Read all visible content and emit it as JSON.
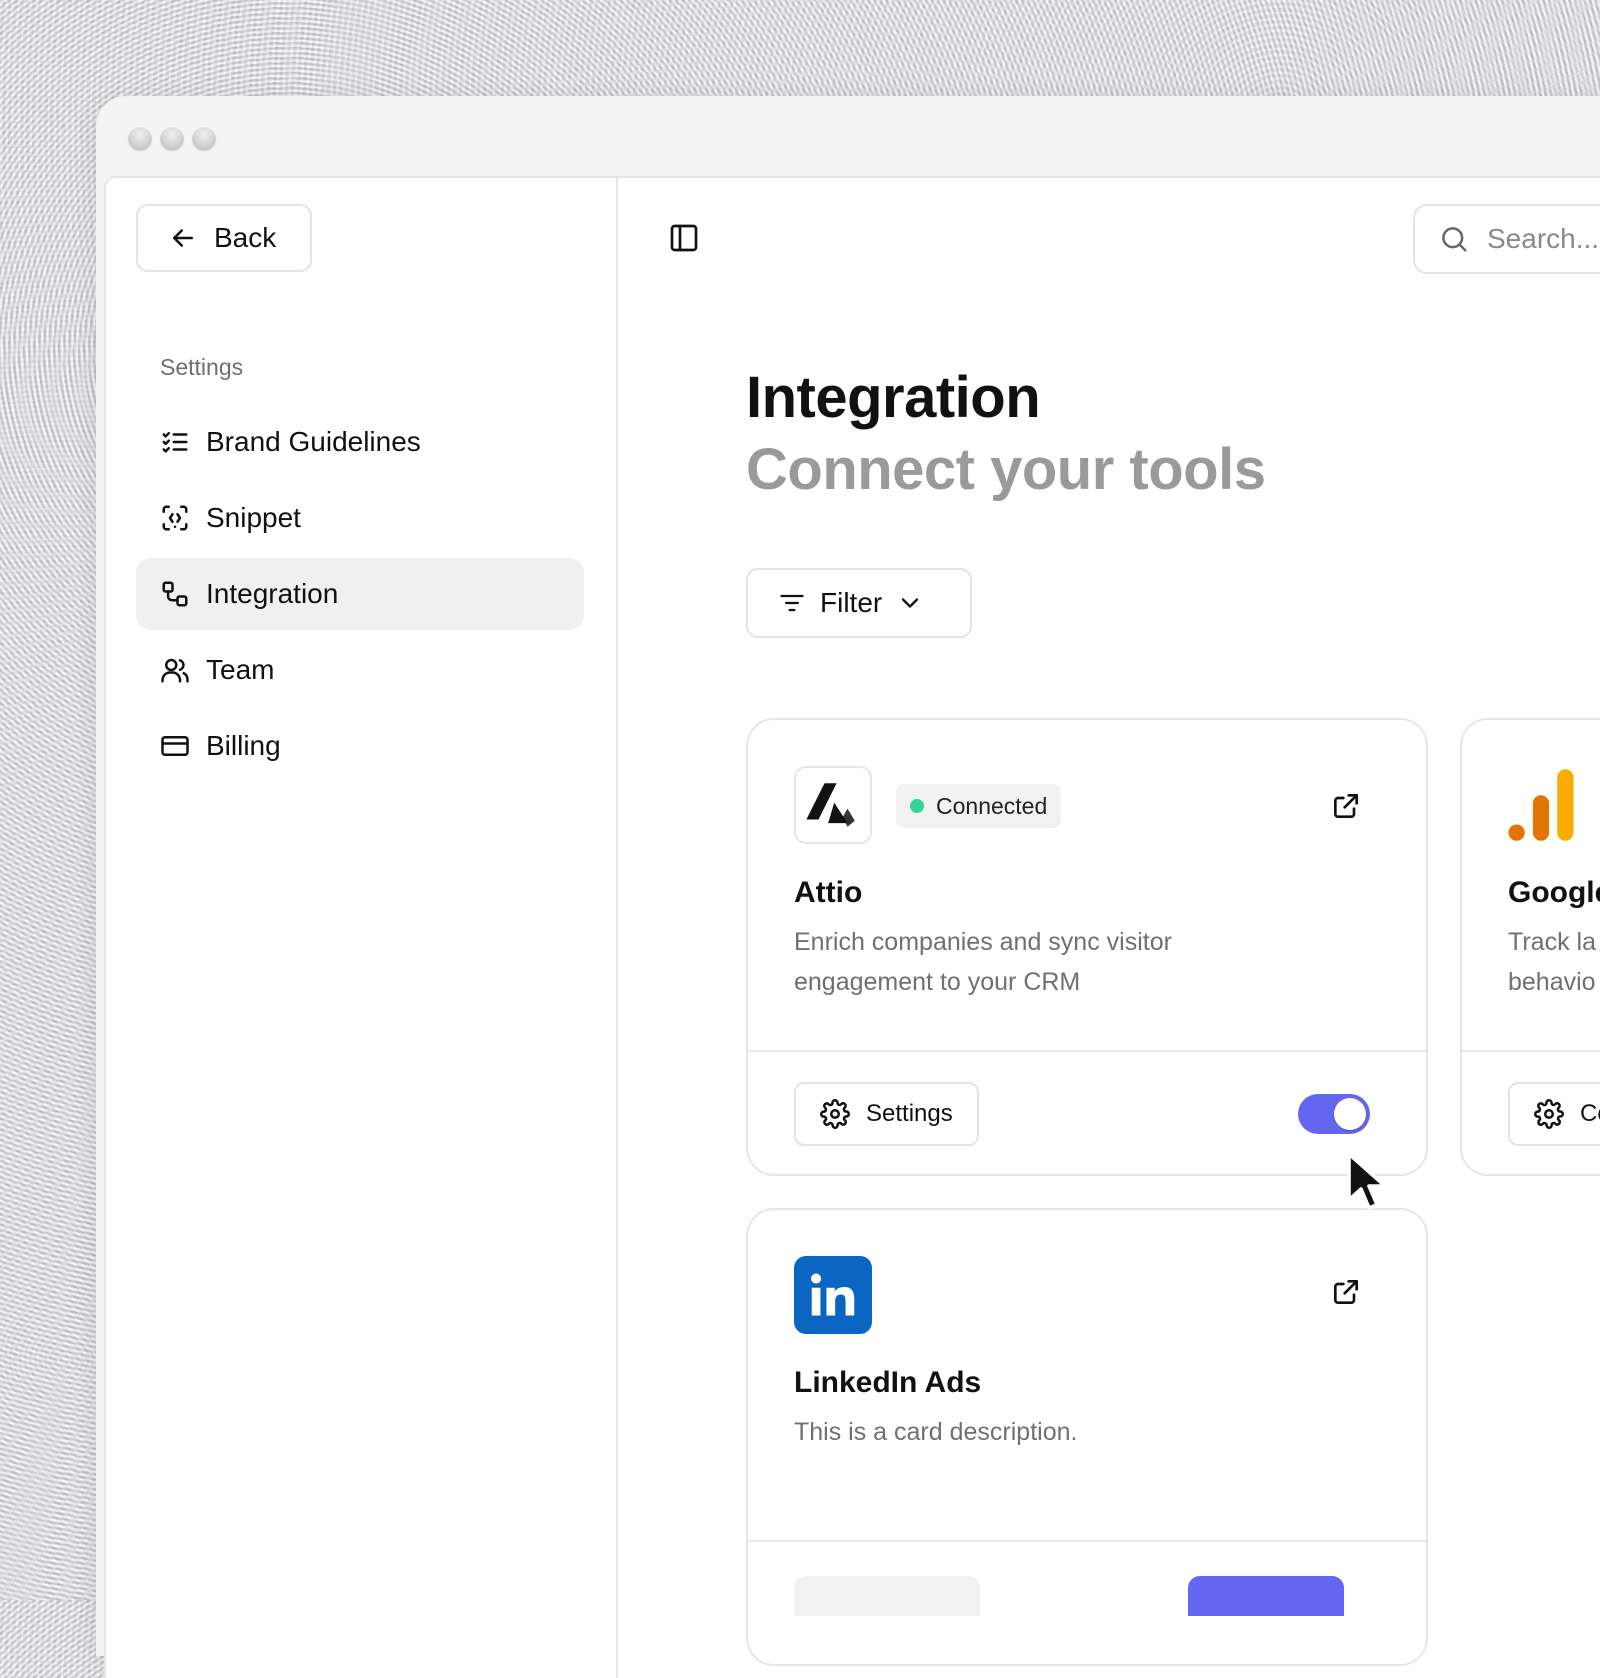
{
  "window": {
    "controls": [
      "close",
      "minimize",
      "zoom"
    ]
  },
  "sidebar": {
    "back_label": "Back",
    "section_label": "Settings",
    "items": [
      {
        "label": "Brand Guidelines",
        "icon": "checklist-icon",
        "active": false
      },
      {
        "label": "Snippet",
        "icon": "code-snippet-icon",
        "active": false
      },
      {
        "label": "Integration",
        "icon": "integration-icon",
        "active": true
      },
      {
        "label": "Team",
        "icon": "users-icon",
        "active": false
      },
      {
        "label": "Billing",
        "icon": "credit-card-icon",
        "active": false
      }
    ]
  },
  "header": {
    "search_placeholder": "Search..."
  },
  "main": {
    "title": "Integration",
    "subtitle": "Connect your tools",
    "filter_label": "Filter"
  },
  "cards": [
    {
      "name": "Attio",
      "description": "Enrich companies and sync visitor engagement to your CRM",
      "badge": "Connected",
      "badge_dot_color": "#34c759",
      "settings_label": "Settings",
      "toggle_on": true,
      "toggle_color": "#6366f1"
    },
    {
      "name": "Google",
      "description": "Track la behavio",
      "settings_label": "Co"
    },
    {
      "name": "LinkedIn Ads",
      "description": "This is a card description.",
      "logo_color": "#0a66c2"
    }
  ]
}
